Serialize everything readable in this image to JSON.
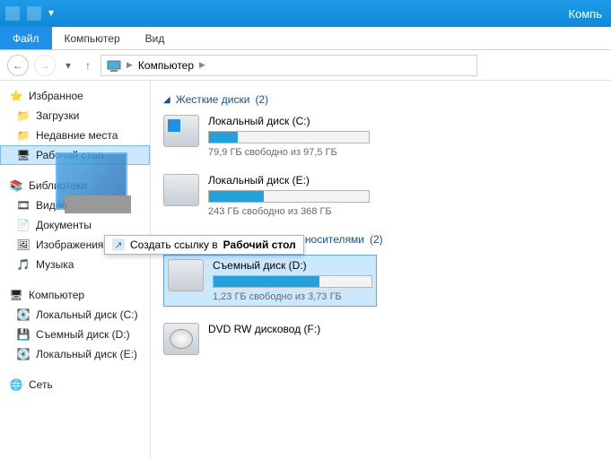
{
  "titlebar": {
    "title": "Компь"
  },
  "ribbon": {
    "file": "Файл",
    "tabs": [
      "Компьютер",
      "Вид"
    ]
  },
  "breadcrumb": {
    "location": "Компьютер"
  },
  "sidebar": {
    "favorites": {
      "label": "Избранное",
      "items": [
        "Загрузки",
        "Недавние места",
        "Рабочий стол"
      ]
    },
    "libraries": {
      "label": "Библиотеки",
      "items": [
        "Видео",
        "Документы",
        "Изображения",
        "Музыка"
      ]
    },
    "computer": {
      "label": "Компьютер",
      "items": [
        "Локальный диск (C:)",
        "Съемный диск (D:)",
        "Локальный диск (E:)"
      ]
    },
    "network": {
      "label": "Сеть"
    }
  },
  "content": {
    "section1": {
      "title": "Жесткие диски",
      "count": "(2)"
    },
    "section2": {
      "title": "Устройства со съемными носителями",
      "count": "(2)"
    },
    "drives": {
      "c": {
        "name": "Локальный диск (C:)",
        "stat": "79,9 ГБ свободно из 97,5 ГБ",
        "fill": 18
      },
      "e": {
        "name": "Локальный диск (E:)",
        "stat": "243 ГБ свободно из 368 ГБ",
        "fill": 34
      },
      "d": {
        "name": "Съемный диск (D:)",
        "stat": "1,23 ГБ свободно из 3,73 ГБ",
        "fill": 67
      },
      "f": {
        "name": "DVD RW дисковод (F:)"
      }
    }
  },
  "drag": {
    "action": "Создать ссылку в",
    "dest": "Рабочий стол"
  }
}
